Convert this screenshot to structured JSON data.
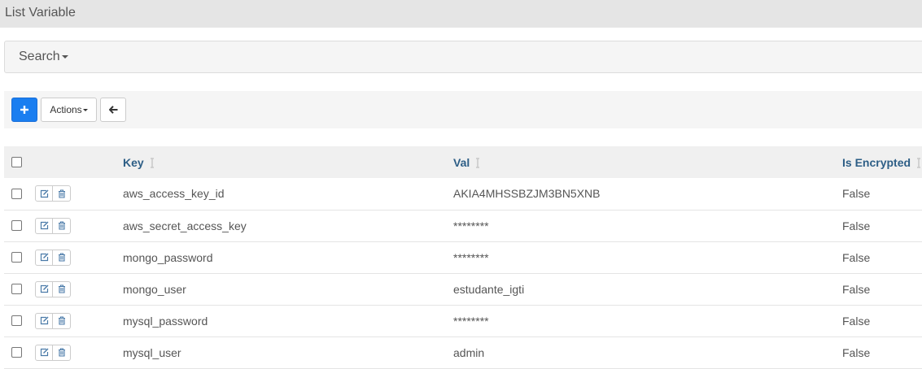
{
  "page": {
    "title": "List Variable"
  },
  "search": {
    "label": "Search"
  },
  "toolbar": {
    "actions_label": "Actions"
  },
  "table": {
    "columns": {
      "key": "Key",
      "val": "Val",
      "is_encrypted": "Is Encrypted"
    },
    "rows": [
      {
        "key": "aws_access_key_id",
        "val": "AKIA4MHSSBZJM3BN5XNB",
        "is_encrypted": "False"
      },
      {
        "key": "aws_secret_access_key",
        "val": "********",
        "is_encrypted": "False"
      },
      {
        "key": "mongo_password",
        "val": "********",
        "is_encrypted": "False"
      },
      {
        "key": "mongo_user",
        "val": "estudante_igti",
        "is_encrypted": "False"
      },
      {
        "key": "mysql_password",
        "val": "********",
        "is_encrypted": "False"
      },
      {
        "key": "mysql_user",
        "val": "admin",
        "is_encrypted": "False"
      }
    ]
  },
  "icons": {
    "add": "plus-icon",
    "back": "arrow-left-icon",
    "edit": "edit-icon",
    "delete": "trash-icon",
    "sort": "sort-icon",
    "dropdown": "caret-down-icon"
  },
  "colors": {
    "accent": "#1a7ef0",
    "header_text": "#2d5e86",
    "title_bar_bg": "#e5e5e5",
    "panel_bg": "#f5f5f5"
  }
}
